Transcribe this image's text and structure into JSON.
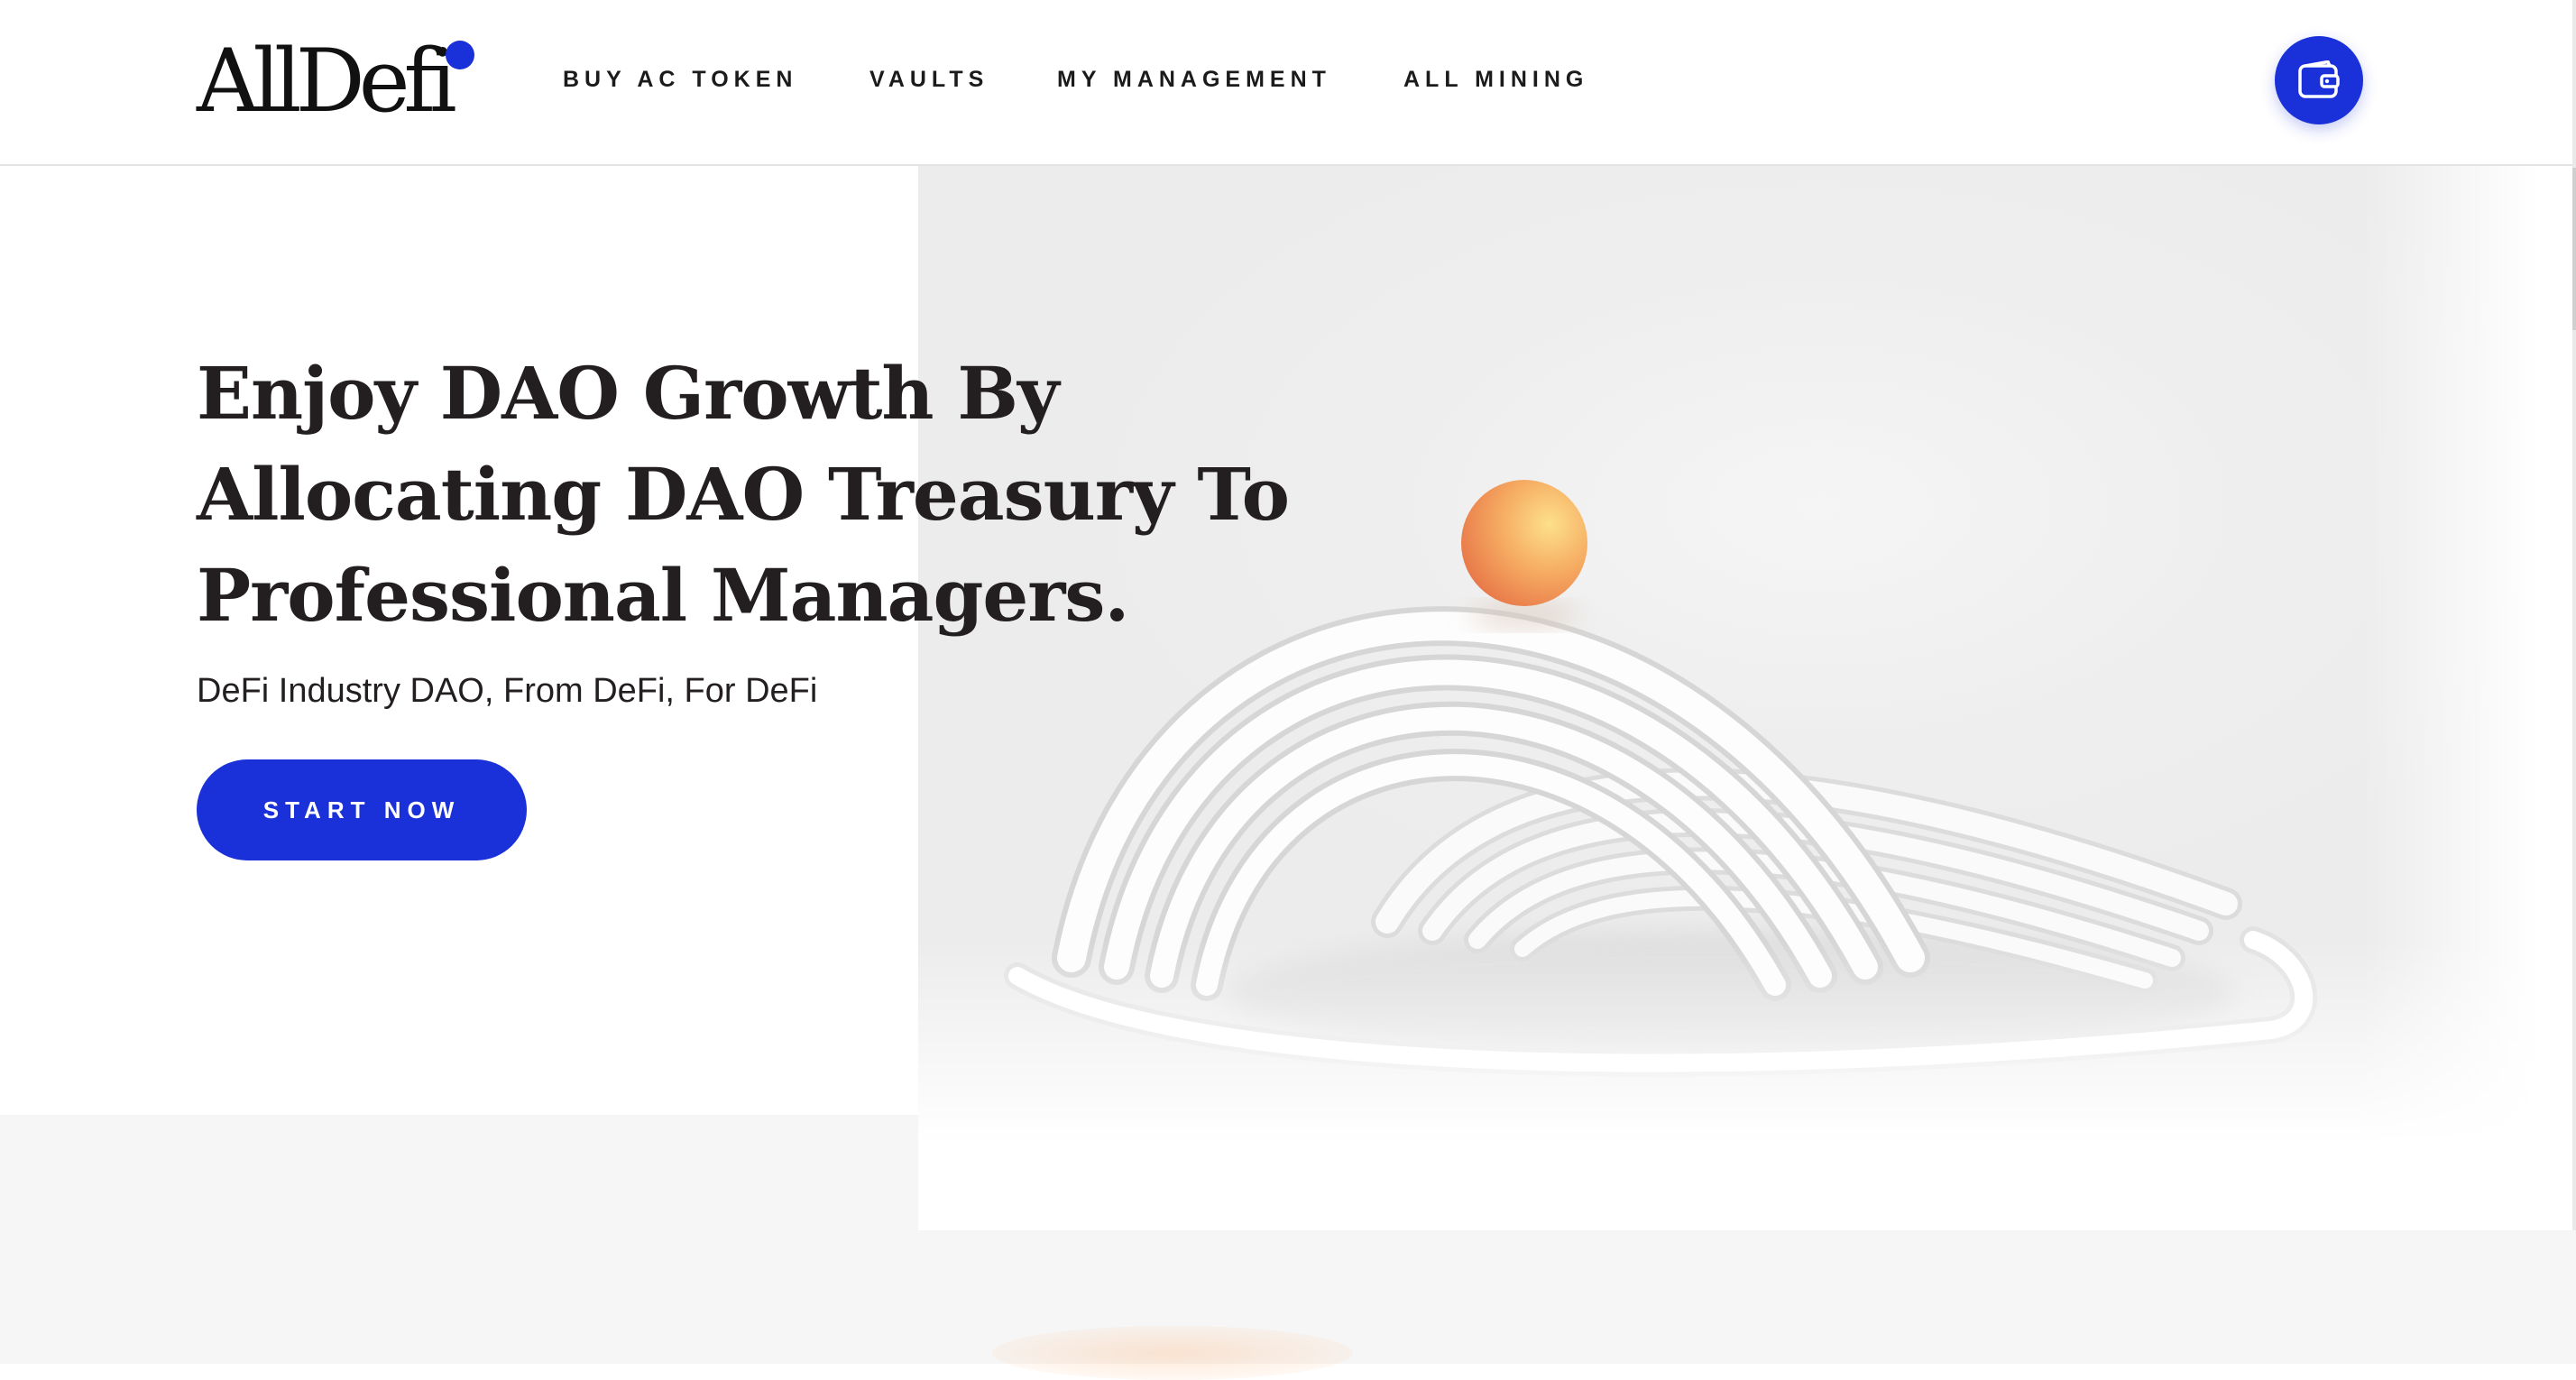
{
  "brand": {
    "logo_text": "AllDefi"
  },
  "nav": {
    "items": [
      {
        "label": "BUY AC TOKEN"
      },
      {
        "label": "VAULTS"
      },
      {
        "label": "MY MANAGEMENT"
      },
      {
        "label": "ALL MINING"
      }
    ]
  },
  "header": {
    "wallet_icon": "wallet-icon"
  },
  "hero": {
    "title": "Enjoy DAO Growth By Allocating DAO Treasury To Professional Managers.",
    "subtitle": "DeFi Industry DAO, From DeFi, For DeFi",
    "cta_label": "START NOW"
  },
  "colors": {
    "accent": "#1a31d9",
    "text": "#231f20",
    "sphere": "#f2a25c"
  }
}
